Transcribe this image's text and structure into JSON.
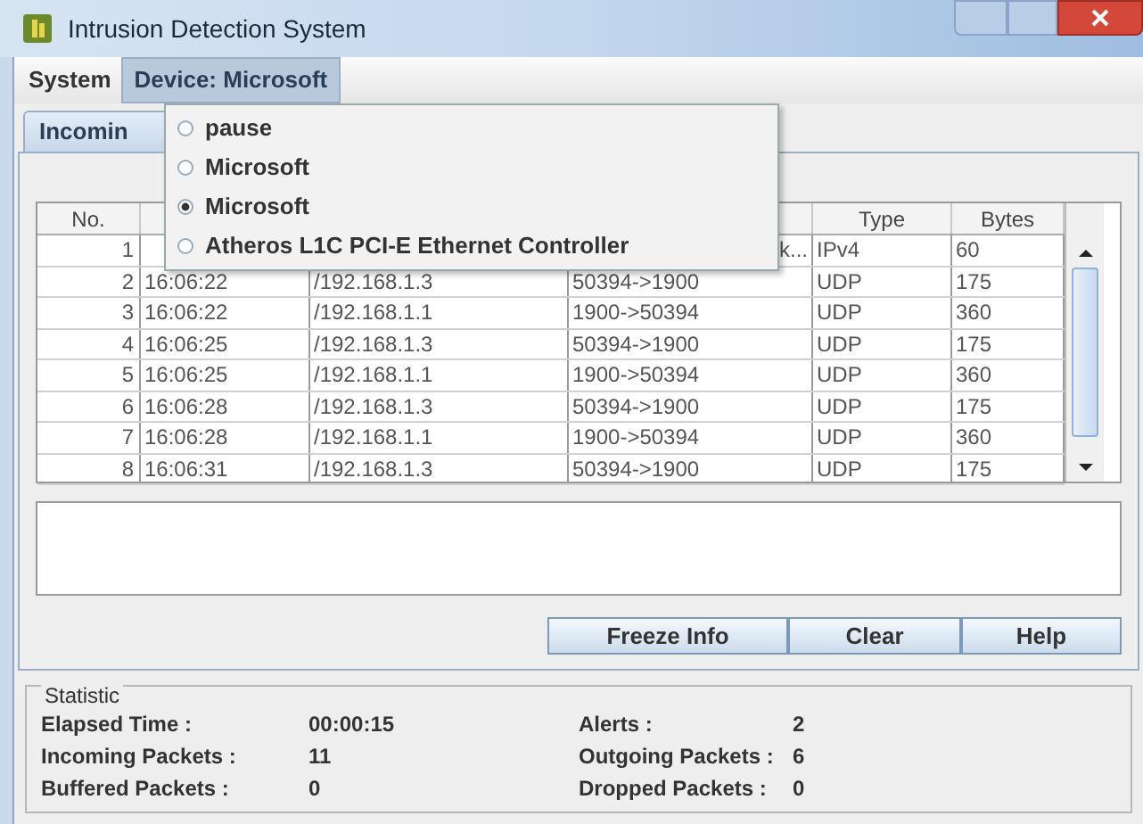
{
  "window": {
    "title": "Intrusion Detection System"
  },
  "menu_bar": [
    {
      "label": "System",
      "selected": false
    },
    {
      "label": "Device: Microsoft",
      "selected": true
    }
  ],
  "device_menu": [
    {
      "label": "pause",
      "selected": false
    },
    {
      "label": "Microsoft",
      "selected": false
    },
    {
      "label": "Microsoft",
      "selected": true
    },
    {
      "label": "Atheros L1C PCI-E Ethernet Controller",
      "selected": false
    }
  ],
  "tabs": [
    {
      "label": "Incomin",
      "selected": true
    }
  ],
  "table": {
    "columns": [
      {
        "label": "No."
      },
      {},
      {},
      {},
      {
        "label": "Type"
      },
      {
        "label": "Bytes"
      }
    ],
    "rows": [
      [
        "1",
        null,
        null,
        {
          "text": "k...",
          "cut": true
        },
        "IPv4",
        "60"
      ],
      [
        "2",
        "16:06:22",
        "/192.168.1.3",
        "50394->1900",
        "UDP",
        "175"
      ],
      [
        "3",
        "16:06:22",
        "/192.168.1.1",
        "1900->50394",
        "UDP",
        "360"
      ],
      [
        "4",
        "16:06:25",
        "/192.168.1.3",
        "50394->1900",
        "UDP",
        "175"
      ],
      [
        "5",
        "16:06:25",
        "/192.168.1.1",
        "1900->50394",
        "UDP",
        "360"
      ],
      [
        "6",
        "16:06:28",
        "/192.168.1.3",
        "50394->1900",
        "UDP",
        "175"
      ],
      [
        "7",
        "16:06:28",
        "/192.168.1.1",
        "1900->50394",
        "UDP",
        "360"
      ],
      [
        "8",
        "16:06:31",
        "/192.168.1.3",
        "50394->1900",
        "UDP",
        "175"
      ]
    ]
  },
  "buttons": [
    "Freeze Info",
    "Clear",
    "Help"
  ],
  "statistic": {
    "title": "Statistic",
    "items": [
      {
        "label": "Elapsed Time :",
        "value": "00:00:15"
      },
      {
        "label": "Alerts :",
        "value": "2"
      },
      {
        "label": "Incoming Packets :",
        "value": "11"
      },
      {
        "label": "Outgoing Packets :",
        "value": "6"
      },
      {
        "label": "Buffered Packets :",
        "value": "0"
      },
      {
        "label": "Dropped Packets :",
        "value": "0"
      }
    ]
  }
}
